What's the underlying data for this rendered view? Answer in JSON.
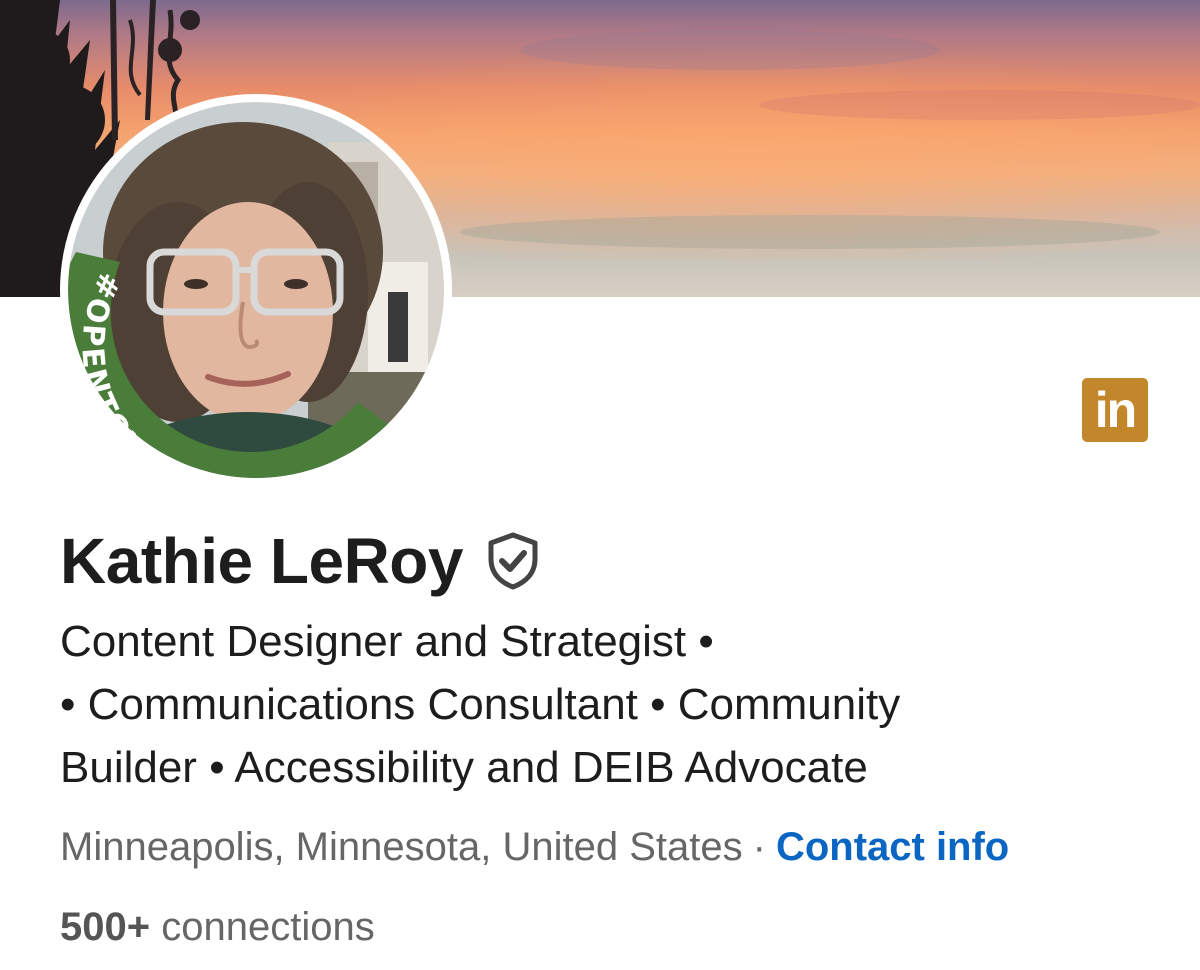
{
  "profile": {
    "name": "Kathie LeRoy",
    "verified_icon": "shield-check-icon",
    "headline": "Content Designer and Strategist • • Communications Consultant • Community Builder • Accessibility and DEIB Advocate",
    "headline_lines": [
      "Content Designer and Strategist •",
      "• Communications Consultant • Community",
      "Builder • Accessibility and DEIB Advocate"
    ],
    "location": "Minneapolis, Minnesota, United States",
    "separator": "·",
    "contact_label": "Contact info",
    "connections_count": "500+",
    "connections_label": "connections"
  },
  "avatar": {
    "frame_text": "#OPENTOWORK",
    "frame_color": "#4a7c3a"
  },
  "brand": {
    "badge_text": "in",
    "badge_icon": "linkedin-icon",
    "badge_color": "#c2872b",
    "link_color": "#0a66c2"
  }
}
